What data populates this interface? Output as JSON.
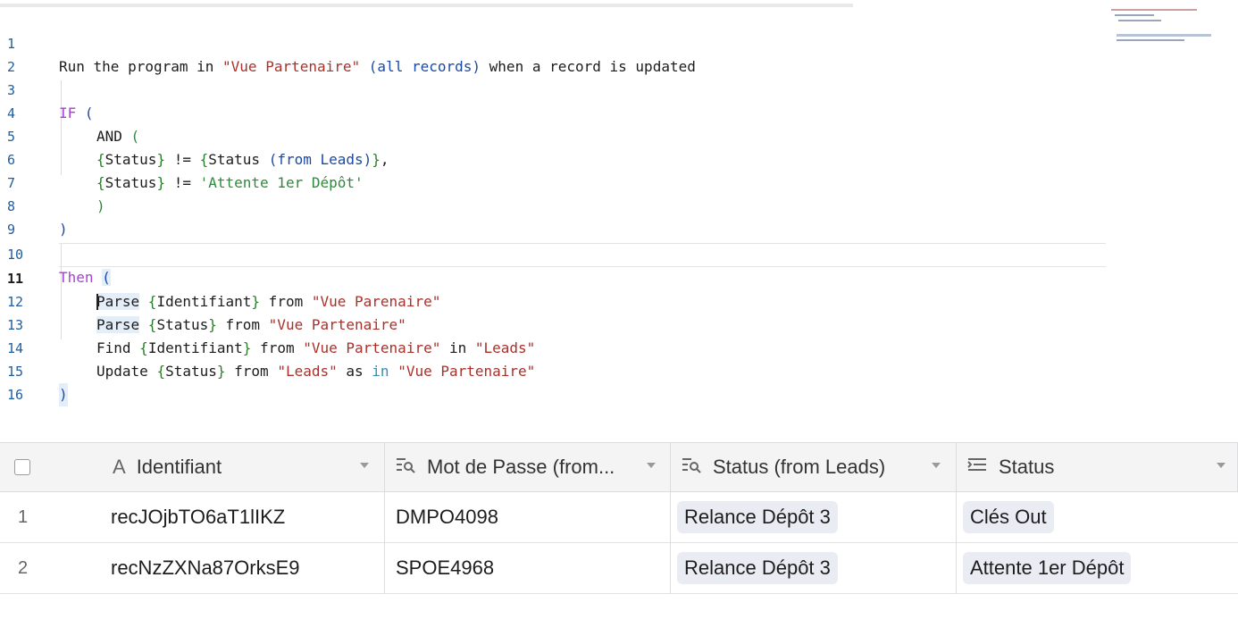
{
  "editor": {
    "line_numbers": [
      "1",
      "2",
      "3",
      "4",
      "5",
      "6",
      "7",
      "8",
      "9",
      "10",
      "11",
      "12",
      "13",
      "14",
      "15",
      "16"
    ],
    "l1": {
      "a": "Run the program in ",
      "b": "\"Vue Partenaire\"",
      "c": " ",
      "d": "(all records)",
      "e": " when a record is updated"
    },
    "l3": {
      "kw": "IF",
      "p": " ("
    },
    "l4": {
      "t": "AND ("
    },
    "l5": {
      "a": "{Status}",
      "b": " != ",
      "c": "{Status ",
      "d": "(from Leads)",
      "e": "}",
      ",": ","
    },
    "l6": {
      "a": "{Status}",
      "b": " != ",
      "c": "'Attente 1er Dépôt'"
    },
    "l7": {
      "t": ")"
    },
    "l8": {
      "t": ")"
    },
    "l10": {
      "kw": "Then",
      "p": "("
    },
    "l11": {
      "a": "Parse",
      "b": " {Identifiant}",
      "c": " from ",
      "d": "\"Vue Parenaire\""
    },
    "l12": {
      "a": "Parse",
      "b": " {Status}",
      "c": " from ",
      "d": "\"Vue Partenaire\""
    },
    "l13": {
      "a": "Find ",
      "b": "{Identifiant}",
      "c": " from ",
      "d": "\"Vue Partenaire\"",
      "e": " in ",
      "f": "\"Leads\""
    },
    "l14": {
      "a": "Update ",
      "b": "{Status}",
      "c": " from ",
      "d": "\"Leads\"",
      "e": " as ",
      "f": "in",
      "g": " ",
      "h": "\"Vue Partenaire\""
    },
    "l15": {
      "t": ")"
    }
  },
  "grid": {
    "columns": [
      {
        "label": "Identifiant",
        "icon": "text-field-icon"
      },
      {
        "label": "Mot de Passe (from...",
        "icon": "lookup-field-icon"
      },
      {
        "label": "Status (from Leads)",
        "icon": "lookup-field-icon"
      },
      {
        "label": "Status",
        "icon": "long-text-field-icon"
      }
    ],
    "rows": [
      {
        "num": "1",
        "identifiant": "recJOjbTO6aT1lIKZ",
        "mdp": "DMPO4098",
        "status_leads": "Relance Dépôt 3",
        "status": "Clés Out"
      },
      {
        "num": "2",
        "identifiant": "recNzZXNa87OrksE9",
        "mdp": "SPOE4968",
        "status_leads": "Relance Dépôt 3",
        "status": "Attente 1er Dépôt"
      }
    ]
  }
}
